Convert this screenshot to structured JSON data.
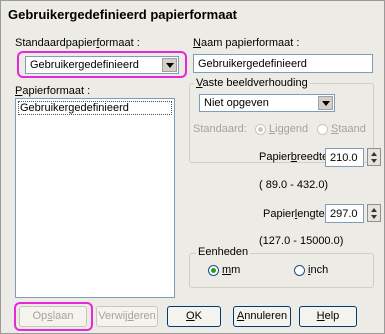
{
  "window": {
    "title": "Gebruikergedefinieerd papierformaat"
  },
  "left": {
    "std_label_pre": "Standaardpapier",
    "std_label_u": "f",
    "std_label_post": "ormaat :",
    "std_value": "Gebruikergedefinieerd",
    "list_label_u": "P",
    "list_label_post": "apierformaat :",
    "list_items": [
      "Gebruikergedefinieerd"
    ]
  },
  "right": {
    "name_label_u": "N",
    "name_label_post": "aam papierformaat :",
    "name_value": "Gebruikergedefinieerd",
    "aspect_label_u": "V",
    "aspect_label_post": "aste beeldverhouding",
    "aspect_value": "Niet opgeven",
    "orient_label": "Standaard:",
    "portrait_u": "L",
    "portrait_post": "iggend",
    "landscape_u": "S",
    "landscape_post": "taand",
    "width_label_pre": "Papier",
    "width_label_u": "b",
    "width_label_post": "reedte :",
    "width_value": "210.0",
    "width_range": "( 89.0 - 432.0)",
    "height_label_pre": "Papier",
    "height_label_u": "l",
    "height_label_post": "engte :",
    "height_value": "297.0",
    "height_range": "(127.0 - 15000.0)",
    "units_label": "Eenheden",
    "unit_mm_u": "m",
    "unit_mm_post": "m",
    "unit_inch_u": "i",
    "unit_inch_post": "nch",
    "selected_unit": "mm"
  },
  "buttons": {
    "save_pre": "Op",
    "save_u": "s",
    "save_post": "laan",
    "delete_pre": "Verwij",
    "delete_u": "d",
    "delete_post": "eren",
    "ok_u": "O",
    "ok_post": "K",
    "cancel_u": "A",
    "cancel_post": "nnuleren",
    "help_u": "H",
    "help_post": "elp"
  },
  "colors": {
    "highlight": "#e62ad8",
    "dialog_bg": "#ecebe6"
  }
}
